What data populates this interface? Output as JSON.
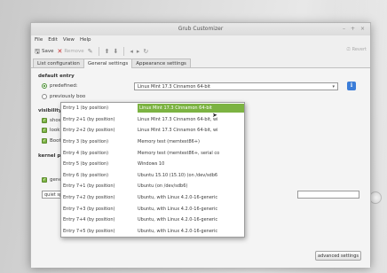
{
  "window": {
    "title": "Grub Customizer",
    "controls": [
      "–",
      "+",
      "×"
    ]
  },
  "menubar": [
    "File",
    "Edit",
    "View",
    "Help"
  ],
  "toolbar": {
    "save_label": "Save",
    "remove_label": "Remove",
    "reset_label": "Revert"
  },
  "tabs": [
    "List configuration",
    "General settings",
    "Appearance settings"
  ],
  "general": {
    "default_entry_title": "default entry",
    "predefined_label": "predefined:",
    "predefined_value": "Linux Mint 17.3 Cinnamon 64-bit",
    "previously_booted_label": "previously boo",
    "visibility_title": "visibility",
    "show_menu_label": "show menu",
    "look_for_other_label": "look for other",
    "boot_default_label": "Boot default e",
    "kernel_title": "kernel parameters",
    "kernel_value": "quiet splash",
    "generate_label": "generate reco",
    "advanced_label": "advanced settings"
  },
  "dropdown": {
    "items": [
      {
        "left": "Entry 1 (by position)",
        "right": "Linux Mint 17.3 Cinnamon 64-bit"
      },
      {
        "left": "Entry 2+1 (by position)",
        "right": "Linux Mint 17.3 Cinnamon 64-bit, wi"
      },
      {
        "left": "Entry 2+2 (by position)",
        "right": "Linux Mint 17.3 Cinnamon 64-bit, wi"
      },
      {
        "left": "Entry 3 (by position)",
        "right": "Memory test (memtest86+)"
      },
      {
        "left": "Entry 4 (by position)",
        "right": "Memory test (memtest86+, serial co"
      },
      {
        "left": "Entry 5 (by position)",
        "right": "Windows 10"
      },
      {
        "left": "Entry 6 (by position)",
        "right": "Ubuntu 15.10 (15.10) (on /dev/sdb6"
      },
      {
        "left": "Entry 7+1 (by position)",
        "right": "Ubuntu (on /dev/sdb6)"
      },
      {
        "left": "Entry 7+2 (by position)",
        "right": "Ubuntu, with Linux 4.2.0-16-generic"
      },
      {
        "left": "Entry 7+3 (by position)",
        "right": "Ubuntu, with Linux 4.2.0-16-generic"
      },
      {
        "left": "Entry 7+4 (by position)",
        "right": "Ubuntu, with Linux 4.2.0-16-generic"
      },
      {
        "left": "Entry 7+5 (by position)",
        "right": "Ubuntu, with Linux 4.2.0-16-generic"
      }
    ]
  },
  "colors": {
    "accent_green": "#7cb342",
    "remove_red": "#c62828",
    "info_blue": "#3b7dd8"
  }
}
